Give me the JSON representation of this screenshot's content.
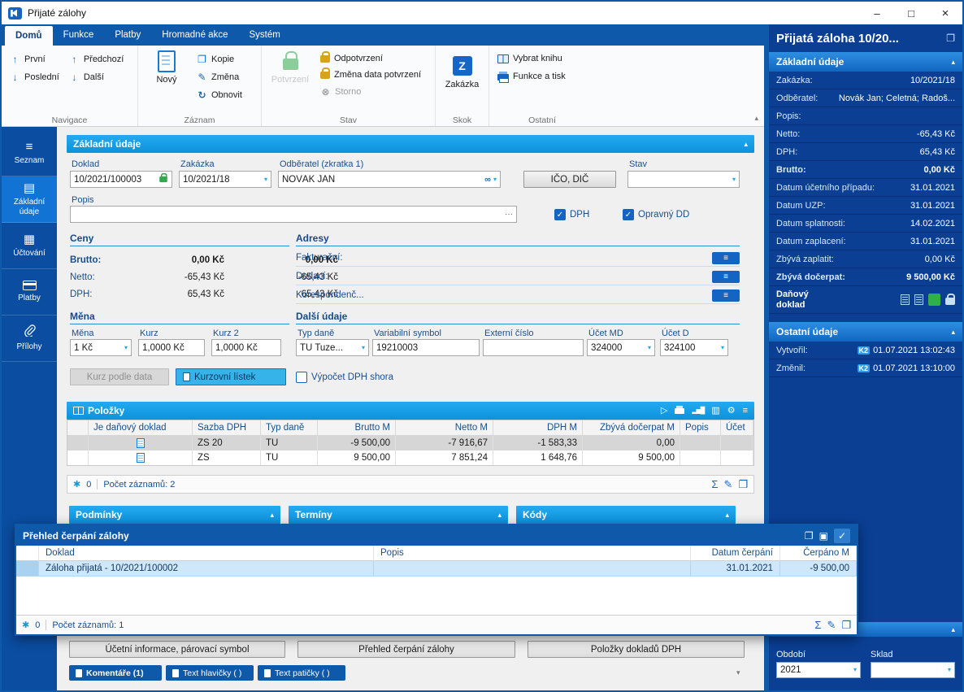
{
  "window": {
    "title": "Přijaté zálohy"
  },
  "icons": {
    "minimize": "–",
    "maximize": "□",
    "close": "×",
    "up": "↑",
    "down": "↓",
    "refresh": "↻",
    "edit": "✎",
    "copy": "❐",
    "cancel": "⊗",
    "check": "✓",
    "chevron_up": "▴",
    "chevron_down": "▾",
    "dots": "···",
    "hamburger": "≡",
    "sum": "Σ",
    "star": "✱",
    "play": "▷",
    "gear": "⚙",
    "columns": "▥",
    "grid": "▦",
    "list": "▤",
    "chart": "▂▅█",
    "dock": "▣",
    "zakazka_letter": "Z"
  },
  "tabs": [
    {
      "label": "Domů"
    },
    {
      "label": "Funkce"
    },
    {
      "label": "Platby"
    },
    {
      "label": "Hromadné akce"
    },
    {
      "label": "Systém"
    }
  ],
  "ribbon": {
    "navigace": {
      "label": "Navigace",
      "prvni": "První",
      "posledni": "Poslední",
      "predchozi": "Předchozí",
      "dalsi": "Další"
    },
    "zaznam": {
      "label": "Záznam",
      "novy": "Nový",
      "kopie": "Kopie",
      "zmena": "Změna",
      "obnovit": "Obnovit"
    },
    "stav": {
      "label": "Stav",
      "potvrzeni": "Potvrzení",
      "odpotvrzeni": "Odpotvrzení",
      "zmena_data": "Změna data potvrzení",
      "storno": "Storno"
    },
    "skok": {
      "label": "Skok",
      "zakazka": "Zakázka"
    },
    "ostatni": {
      "label": "Ostatní",
      "vybrat_knihu": "Vybrat knihu",
      "funkce_a_tisk": "Funkce a tisk"
    }
  },
  "sidebar": [
    {
      "label": "Seznam"
    },
    {
      "label": "Základní údaje"
    },
    {
      "label": "Účtování"
    },
    {
      "label": "Platby"
    },
    {
      "label": "Přílohy"
    }
  ],
  "form": {
    "section_title": "Základní údaje",
    "doklad": {
      "label": "Doklad",
      "value": "10/2021/100003"
    },
    "zakazka": {
      "label": "Zakázka",
      "value": "10/2021/18"
    },
    "odberatel": {
      "label": "Odběratel (zkratka 1)",
      "value": "NOVÁK JAN"
    },
    "ico_dic": "IČO, DIČ",
    "stav": {
      "label": "Stav",
      "value": ""
    },
    "popis": {
      "label": "Popis",
      "value": ""
    },
    "dph_checkbox": "DPH",
    "opravny_checkbox": "Opravný DD",
    "ceny": {
      "title": "Ceny",
      "rows": [
        {
          "label": "Brutto:",
          "v1": "0,00 Kč",
          "v2": "0,00 Kč"
        },
        {
          "label": "Netto:",
          "v1": "-65,43 Kč",
          "v2": "-65,43 Kč"
        },
        {
          "label": "DPH:",
          "v1": "65,43 Kč",
          "v2": "65,43 Kč"
        }
      ]
    },
    "adresy": {
      "title": "Adresy",
      "rows": [
        {
          "label": "Fakturační:"
        },
        {
          "label": "Dodací:"
        },
        {
          "label": "Korespondenč..."
        }
      ]
    },
    "mena": {
      "title": "Měna",
      "mena": {
        "label": "Měna",
        "value": "1 Kč"
      },
      "kurz": {
        "label": "Kurz",
        "value": "1,0000 Kč"
      },
      "kurz2": {
        "label": "Kurz 2",
        "value": "1,0000 Kč"
      }
    },
    "dalsi": {
      "title": "Další údaje",
      "typ_dane": {
        "label": "Typ daně",
        "value": "TU Tuze..."
      },
      "var_symbol": {
        "label": "Variabilní symbol",
        "value": "19210003"
      },
      "externi": {
        "label": "Externí číslo",
        "value": ""
      },
      "ucet_md": {
        "label": "Účet MD",
        "value": "324000"
      },
      "ucet_d": {
        "label": "Účet D",
        "value": "324100"
      }
    },
    "kurz_podle_data": "Kurz podle data",
    "kurzovni_listek": "Kurzovní lístek",
    "vypocet_dph": "Výpočet DPH shora"
  },
  "polozky": {
    "title": "Položky",
    "columns": {
      "je_danovy": "Je daňový doklad",
      "sazba": "Sazba DPH",
      "typ": "Typ daně",
      "brutto": "Brutto M",
      "netto": "Netto M",
      "dph": "DPH M",
      "zbyva": "Zbývá dočerpat M",
      "popis": "Popis",
      "ucet": "Účet"
    },
    "rows": [
      {
        "sazba": "ZS 20",
        "typ": "TU",
        "brutto": "-9 500,00",
        "netto": "-7 916,67",
        "dph": "-1 583,33",
        "zbyva": "0,00",
        "popis": "",
        "ucet": ""
      },
      {
        "sazba": "ZS",
        "typ": "TU",
        "brutto": "9 500,00",
        "netto": "7 851,24",
        "dph": "1 648,76",
        "zbyva": "9 500,00",
        "popis": "",
        "ucet": ""
      }
    ],
    "count": "0",
    "records": "Počet záznamů: 2"
  },
  "sections": {
    "podminky": "Podmínky",
    "terminy": "Termíny",
    "kody": "Kódy"
  },
  "dialog": {
    "title": "Přehled čerpání zálohy",
    "columns": {
      "doklad": "Doklad",
      "popis": "Popis",
      "datum": "Datum čerpání",
      "cerpano": "Čerpáno M"
    },
    "rows": [
      {
        "doklad": "Záloha přijatá - 10/2021/100002",
        "popis": "",
        "datum": "31.01.2021",
        "cerpano": "-9 500,00"
      }
    ],
    "count": "0",
    "records": "Počet záznamů: 1"
  },
  "bottom_buttons": [
    {
      "label": "Účetní informace, párovací symbol"
    },
    {
      "label": "Přehled čerpání zálohy"
    },
    {
      "label": "Položky dokladů DPH"
    }
  ],
  "bottom_tabs": [
    {
      "label": "Komentáře (1)"
    },
    {
      "label": "Text hlavičky ( )"
    },
    {
      "label": "Text patičky ( )"
    }
  ],
  "panel": {
    "title": "Přijatá záloha 10/20...",
    "zakladni": {
      "title": "Základní údaje",
      "rows": [
        {
          "label": "Zakázka:",
          "value": "10/2021/18"
        },
        {
          "label": "Odběratel:",
          "value": "Novák Jan; Celetná; Radoš..."
        },
        {
          "label": "Popis:",
          "value": ""
        },
        {
          "label": "Netto:",
          "value": "-65,43 Kč"
        },
        {
          "label": "DPH:",
          "value": "65,43 Kč"
        },
        {
          "label": "Brutto:",
          "value": "0,00 Kč"
        },
        {
          "label": "Datum účetního případu:",
          "value": "31.01.2021"
        },
        {
          "label": "Datum UZP:",
          "value": "31.01.2021"
        },
        {
          "label": "Datum splatnosti:",
          "value": "14.02.2021"
        },
        {
          "label": "Datum zaplacení:",
          "value": "31.01.2021"
        },
        {
          "label": "Zbývá zaplatit:",
          "value": "0,00 Kč"
        },
        {
          "label": "Zbývá dočerpat:",
          "value": "9 500,00 Kč"
        }
      ],
      "danovy_doklad": "Daňový doklad"
    },
    "ostatni": {
      "title": "Ostatní údaje",
      "rows": [
        {
          "label": "Vytvořil:",
          "badge": "K2",
          "value": "01.07.2021 13:02:43"
        },
        {
          "label": "Změnil:",
          "badge": "K2",
          "value": "01.07.2021 13:10:00"
        }
      ]
    },
    "obdobi": {
      "label": "Období",
      "value": "2021"
    },
    "sklad": {
      "label": "Sklad",
      "value": ""
    }
  }
}
